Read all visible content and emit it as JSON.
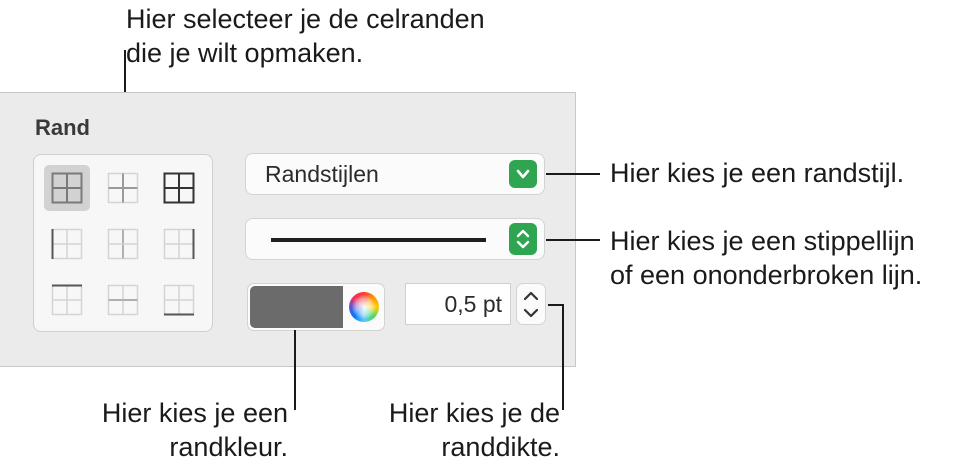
{
  "callouts": {
    "cell_borders": [
      "Hier selecteer je de celranden",
      "die je wilt opmaken."
    ],
    "border_style": [
      "Hier kies je een randstijl."
    ],
    "line_type": [
      "Hier kies je een stippellijn",
      "of een ononderbroken lijn."
    ],
    "border_color": [
      "Hier kies je een",
      "randkleur."
    ],
    "border_width": [
      "Hier kies je de",
      "randdikte."
    ]
  },
  "panel": {
    "title": "Rand",
    "border_style_popup": {
      "label": "Randstijlen",
      "icon": "chevron-down-icon"
    },
    "line_style_popup": {
      "icon": "up-down-chevron-icon"
    },
    "color_well": {
      "fill_color": "#6b6b6b",
      "icon": "color-wheel-icon"
    },
    "width_field": {
      "value": "0,5 pt",
      "icon": "stepper-icon"
    },
    "accent_color": "#2fa552",
    "border_grid": [
      "all-borders",
      "inside-borders",
      "outside-borders",
      "left-border",
      "inside-vertical-borders",
      "right-border",
      "top-border",
      "inside-horizontal-borders",
      "bottom-border"
    ],
    "selected_border": "all-borders"
  }
}
